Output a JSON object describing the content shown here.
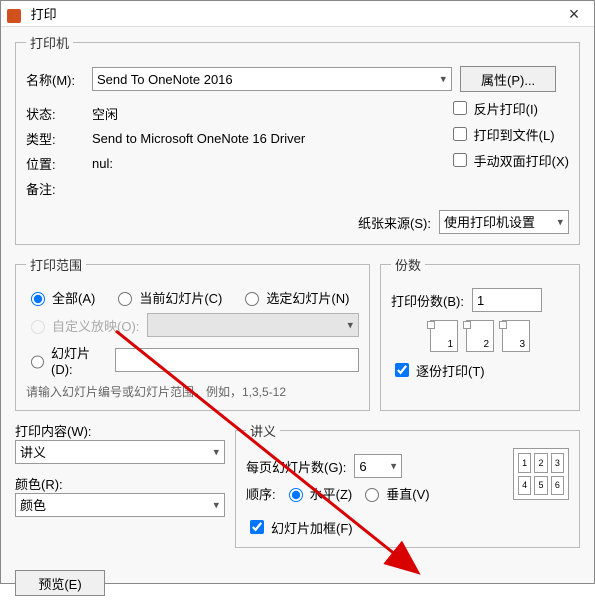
{
  "title": "打印",
  "printer": {
    "legend": "打印机",
    "name_label": "名称(M):",
    "name_value": "Send To OneNote 2016",
    "properties_btn": "属性(P)...",
    "status_label": "状态:",
    "status_value": "空闲",
    "type_label": "类型:",
    "type_value": "Send to Microsoft OneNote 16 Driver",
    "where_label": "位置:",
    "where_value": "nul:",
    "comment_label": "备注:",
    "comment_value": "",
    "reverse_print": "反片打印(I)",
    "print_to_file": "打印到文件(L)",
    "manual_duplex": "手动双面打印(X)",
    "paper_source_label": "纸张来源(S):",
    "paper_source_value": "使用打印机设置"
  },
  "range": {
    "legend": "打印范围",
    "all": "全部(A)",
    "current": "当前幻灯片(C)",
    "selection": "选定幻灯片(N)",
    "custom_show": "自定义放映(O):",
    "slides_label": "幻灯片(D):",
    "hint": "请输入幻灯片编号或幻灯片范围。例如，1,3,5-12"
  },
  "copies": {
    "legend": "份数",
    "count_label": "打印份数(B):",
    "count_value": "1",
    "collate": "逐份打印(T)"
  },
  "content": {
    "label": "打印内容(W):",
    "value": "讲义",
    "color_label": "颜色(R):",
    "color_value": "颜色"
  },
  "handout": {
    "legend": "讲义",
    "per_page_label": "每页幻灯片数(G):",
    "per_page_value": "6",
    "order_label": "顺序:",
    "horizontal": "水平(Z)",
    "vertical": "垂直(V)",
    "frame_slides": "幻灯片加框(F)"
  },
  "buttons": {
    "preview": "预览(E)"
  }
}
